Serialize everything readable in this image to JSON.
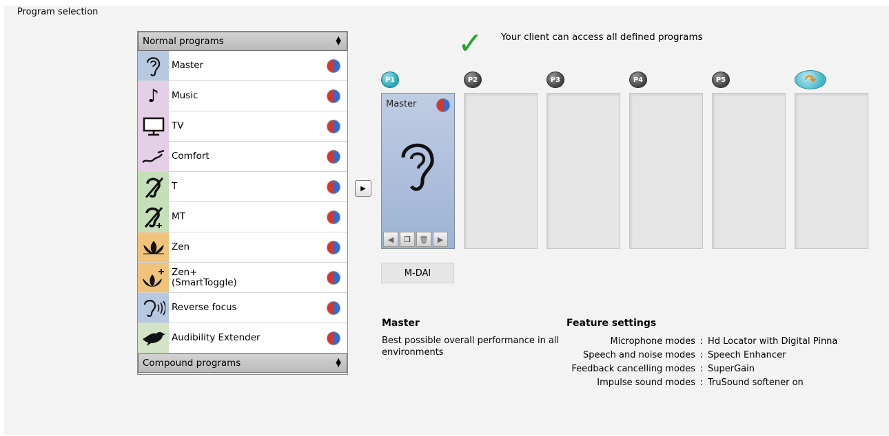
{
  "section_title": "Program selection",
  "program_list": {
    "header": "Normal programs",
    "footer": "Compound programs",
    "items": [
      {
        "label": "Master",
        "icon": "ear-icon",
        "icon_bg": "#b6c9e0"
      },
      {
        "label": "Music",
        "icon": "music-note-icon",
        "icon_bg": "#e4d0e6"
      },
      {
        "label": "TV",
        "icon": "tv-icon",
        "icon_bg": "#e4d0e6"
      },
      {
        "label": "Comfort",
        "icon": "comfort-icon",
        "icon_bg": "#e4d0e6"
      },
      {
        "label": "T",
        "icon": "telecoil-icon",
        "icon_bg": "#c5dfb9"
      },
      {
        "label": "MT",
        "icon": "mic-telecoil-icon",
        "icon_bg": "#c5dfb9"
      },
      {
        "label": "Zen",
        "icon": "lotus-icon",
        "icon_bg": "#f0c37d"
      },
      {
        "label": "Zen+",
        "label2": "(SmartToggle)",
        "icon": "lotus-plus-icon",
        "icon_bg": "#f0c37d"
      },
      {
        "label": "Reverse focus",
        "icon": "reverse-focus-ear-icon",
        "icon_bg": "#b6c9e0"
      },
      {
        "label": "Audibility Extender",
        "icon": "bird-icon",
        "icon_bg": "#d3e4c6"
      }
    ]
  },
  "access_note": "Your client can access all defined programs",
  "slots": [
    {
      "badge": "P1",
      "filled": true,
      "title": "Master"
    },
    {
      "badge": "P2",
      "filled": false
    },
    {
      "badge": "P3",
      "filled": false
    },
    {
      "badge": "P4",
      "filled": false
    },
    {
      "badge": "P5",
      "filled": false
    },
    {
      "badge": "",
      "filled": false,
      "special": true
    }
  ],
  "slot_code": "M-DAI",
  "description": {
    "title": "Master",
    "text": "Best possible overall performance in all environments"
  },
  "features": {
    "title": "Feature settings",
    "rows": [
      {
        "key": "Microphone modes",
        "value": "Hd Locator with Digital Pinna"
      },
      {
        "key": "Speech and noise modes",
        "value": "Speech Enhancer"
      },
      {
        "key": "Feedback cancelling modes",
        "value": "SuperGain"
      },
      {
        "key": "Impulse sound modes",
        "value": "TruSound softener on"
      }
    ]
  },
  "colors": {
    "checkmark": "#24a324",
    "slot_filled": "#a9bcdb"
  }
}
